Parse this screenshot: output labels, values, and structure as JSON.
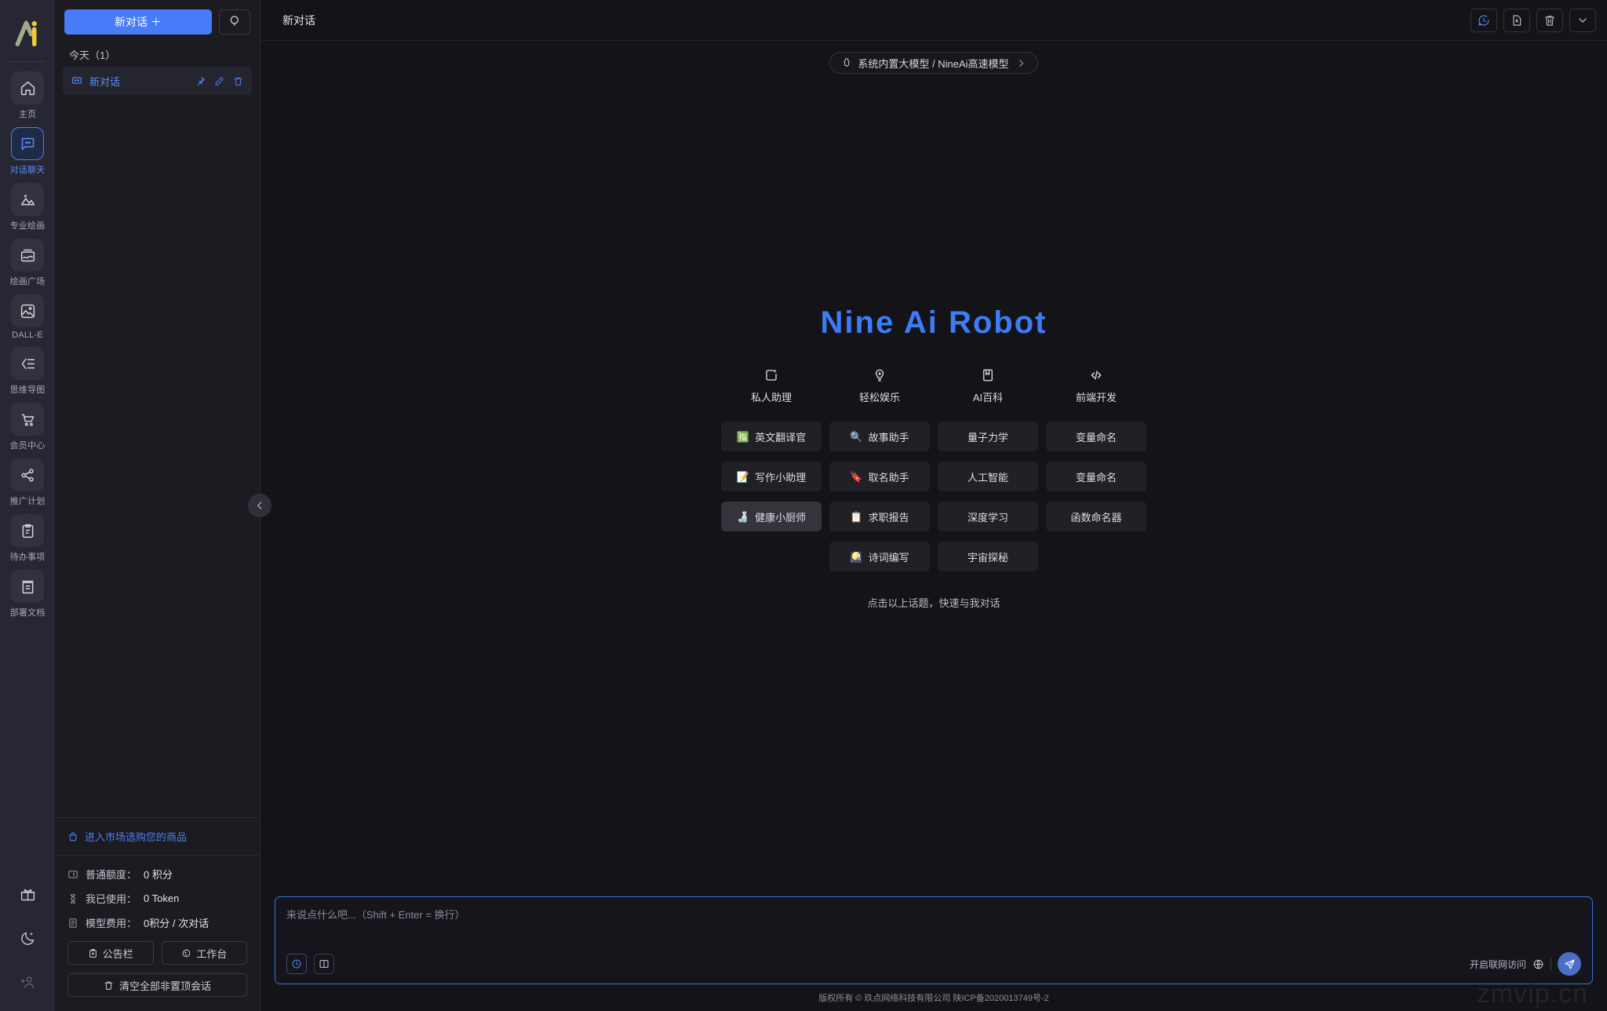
{
  "rail": {
    "logo_alt": "nine-ai-logo",
    "items": [
      {
        "label": "主页",
        "icon": "home-icon",
        "active": false
      },
      {
        "label": "对话聊天",
        "icon": "chat-icon",
        "active": true
      },
      {
        "label": "专业绘画",
        "icon": "image-icon",
        "active": false
      },
      {
        "label": "绘画广场",
        "icon": "gallery-icon",
        "active": false
      },
      {
        "label": "DALL-E",
        "icon": "dalle-icon",
        "active": false
      },
      {
        "label": "思维导图",
        "icon": "mindmap-icon",
        "active": false
      },
      {
        "label": "会员中心",
        "icon": "cart-icon",
        "active": false
      },
      {
        "label": "推广计划",
        "icon": "share-icon",
        "active": false
      },
      {
        "label": "待办事项",
        "icon": "clipboard-icon",
        "active": false
      },
      {
        "label": "部署文档",
        "icon": "document-icon",
        "active": false
      }
    ],
    "bottom_icons": [
      "gift-icon",
      "moon-icon",
      "add-user-icon"
    ]
  },
  "sidebar": {
    "new_chat_label": "新对话",
    "new_chat_plus": "＋",
    "search_icon": "search-icon",
    "group_label": "今天（1）",
    "conversations": [
      {
        "title": "新对话",
        "icon": "chat-bubble-icon",
        "actions": [
          "pin-icon",
          "edit-icon",
          "delete-icon"
        ]
      }
    ],
    "market_link": "进入市场选购您的商品",
    "quota": [
      {
        "icon": "credit-icon",
        "label": "普通额度：",
        "value": "0 积分"
      },
      {
        "icon": "hourglass-icon",
        "label": "我已使用：",
        "value": "0 Token"
      },
      {
        "icon": "receipt-icon",
        "label": "模型费用：",
        "value": "0积分 / 次对话"
      }
    ],
    "buttons": [
      {
        "label": "公告栏",
        "icon": "announcement-icon"
      },
      {
        "label": "工作台",
        "icon": "workbench-icon"
      }
    ],
    "clear_button": {
      "label": "清空全部非置顶会话",
      "icon": "trash-icon"
    },
    "collapse_icon": "chevron-left-icon"
  },
  "topbar": {
    "title": "新对话",
    "actions": [
      {
        "icon": "chat-history-icon",
        "accent": true
      },
      {
        "icon": "save-file-icon",
        "accent": false
      },
      {
        "icon": "trash-icon",
        "accent": false
      },
      {
        "icon": "chevron-down-icon",
        "accent": false
      }
    ]
  },
  "model_selector": {
    "icon": "model-icon",
    "label": "系统内置大模型 / NineAi高速模型",
    "chevron": "chevron-right-icon"
  },
  "welcome": {
    "brand": "Nine Ai Robot",
    "categories": [
      {
        "label": "私人助理",
        "icon": "assistant-icon"
      },
      {
        "label": "轻松娱乐",
        "icon": "bulb-icon"
      },
      {
        "label": "AI百科",
        "icon": "book-icon"
      },
      {
        "label": "前端开发",
        "icon": "code-icon"
      }
    ],
    "columns": [
      [
        {
          "label": "英文翻译官",
          "emoji": "🈯",
          "highlight": false
        },
        {
          "label": "写作小助理",
          "emoji": "📝",
          "highlight": false
        },
        {
          "label": "健康小厨师",
          "emoji": "🍶",
          "highlight": true
        }
      ],
      [
        {
          "label": "故事助手",
          "emoji": "🔍",
          "highlight": false
        },
        {
          "label": "取名助手",
          "emoji": "🔖",
          "highlight": false
        },
        {
          "label": "求职报告",
          "emoji": "📋",
          "highlight": false
        },
        {
          "label": "诗词编写",
          "emoji": "🎑",
          "highlight": false
        }
      ],
      [
        {
          "label": "量子力学",
          "emoji": "",
          "highlight": false
        },
        {
          "label": "人工智能",
          "emoji": "",
          "highlight": false
        },
        {
          "label": "深度学习",
          "emoji": "",
          "highlight": false
        },
        {
          "label": "宇宙探秘",
          "emoji": "",
          "highlight": false
        }
      ],
      [
        {
          "label": "变量命名",
          "emoji": "",
          "highlight": false
        },
        {
          "label": "变量命名",
          "emoji": "",
          "highlight": false
        },
        {
          "label": "函数命名器",
          "emoji": "",
          "highlight": false
        }
      ]
    ],
    "hint": "点击以上话题，快速与我对话"
  },
  "composer": {
    "placeholder": "来说点什么吧...（Shift + Enter = 换行）",
    "value": "",
    "left_buttons": [
      "history-icon",
      "panel-icon"
    ],
    "network_label": "开启联网访问",
    "globe_icon": "globe-icon",
    "send_icon": "send-icon"
  },
  "footer": {
    "text": "版权所有 © 玖点网络科技有限公司  陕ICP备2020013749号-2",
    "watermark": "zmvip.cn"
  },
  "colors": {
    "accent": "#477bf7",
    "brand": "#3c7cf6",
    "rail_bg": "#272733",
    "sidebar_bg": "#1b1b21",
    "main_bg": "#141418",
    "card_bg": "#202026"
  }
}
